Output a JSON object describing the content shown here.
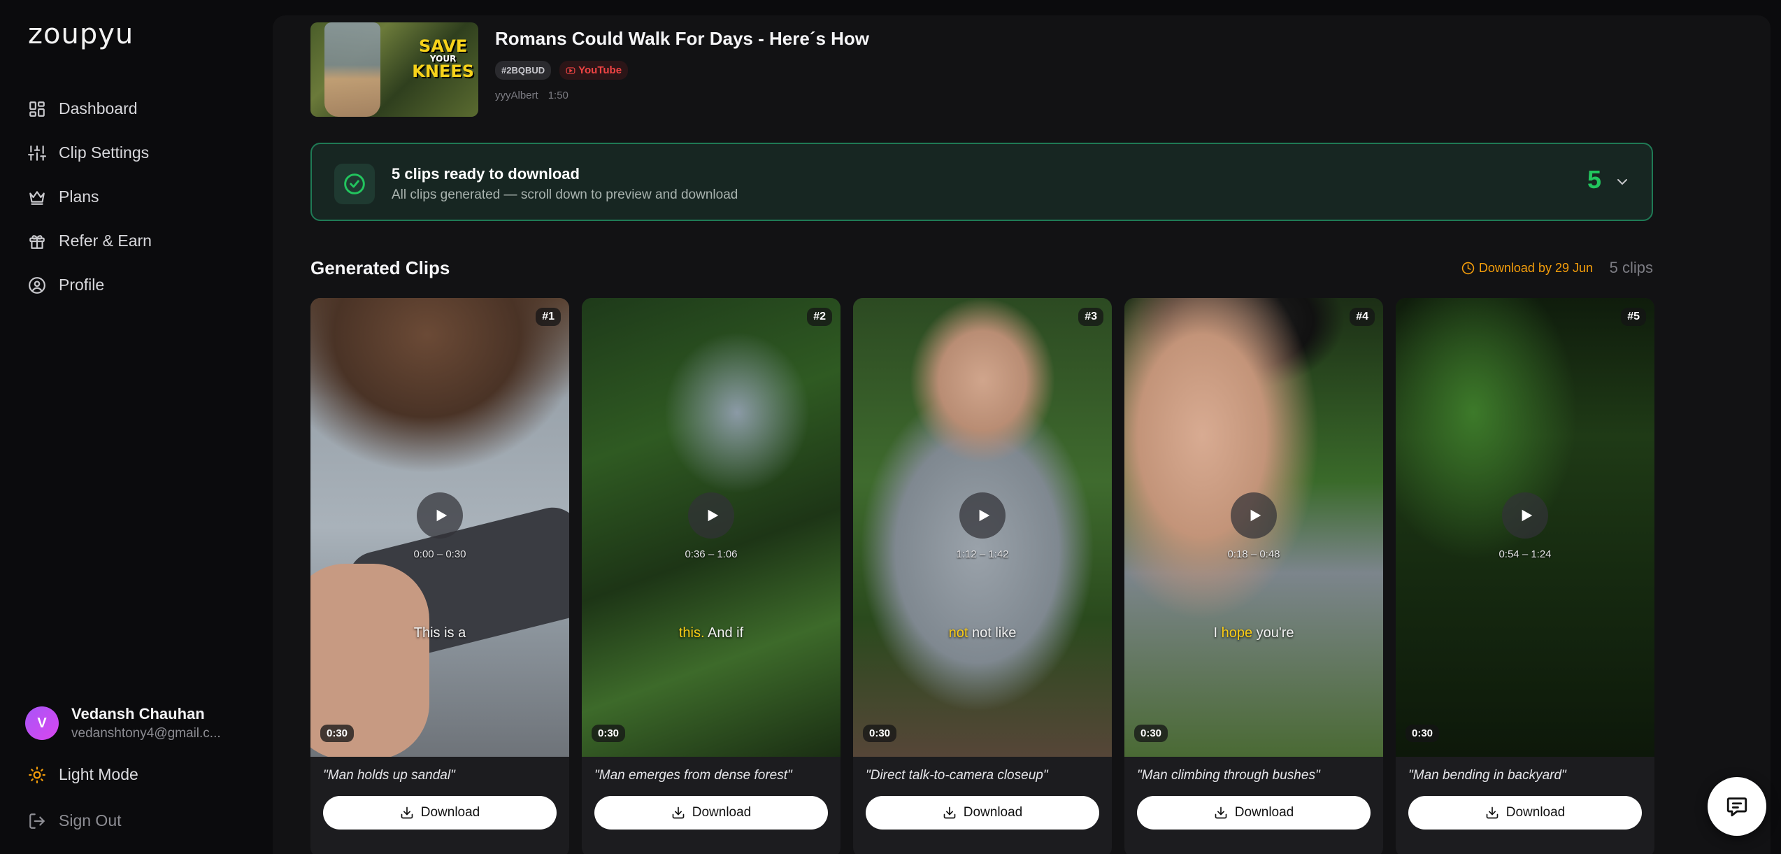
{
  "app": {
    "logo": "zoupyu"
  },
  "sidebar": {
    "items": [
      {
        "label": "Dashboard",
        "icon": "dashboard-icon"
      },
      {
        "label": "Clip Settings",
        "icon": "sliders-icon"
      },
      {
        "label": "Plans",
        "icon": "crown-icon"
      },
      {
        "label": "Refer & Earn",
        "icon": "gift-icon"
      },
      {
        "label": "Profile",
        "icon": "user-circle-icon"
      }
    ],
    "user": {
      "initial": "V",
      "name": "Vedansh Chauhan",
      "email": "vedanshtony4@gmail.c..."
    },
    "light_mode": "Light Mode",
    "sign_out": "Sign Out"
  },
  "video": {
    "title": "Romans Could Walk For Days - Here´s How",
    "id_tag": "#2BQBUD",
    "source": "YouTube",
    "channel": "yyyAlbert",
    "duration": "1:50",
    "thumbnail_text_1": "SAVE",
    "thumbnail_text_2": "YOUR",
    "thumbnail_text_3": "KNEES"
  },
  "ready": {
    "title": "5 clips ready to download",
    "subtitle": "All clips generated — scroll down to preview and download",
    "count": "5"
  },
  "clips_section": {
    "title": "Generated Clips",
    "deadline": "Download by 29 Jun",
    "count_label": "5 clips",
    "download_label": "Download"
  },
  "clips": [
    {
      "num": "#1",
      "range": "0:00 – 0:30",
      "caption_hl": "",
      "caption_rest": "This is a",
      "duration": "0:30",
      "title": "\"Man holds up sandal\""
    },
    {
      "num": "#2",
      "range": "0:36 – 1:06",
      "caption_hl": "this.",
      "caption_rest": " And if",
      "duration": "0:30",
      "title": "\"Man emerges from dense forest\""
    },
    {
      "num": "#3",
      "range": "1:12 – 1:42",
      "caption_hl": "not",
      "caption_rest": " not like",
      "duration": "0:30",
      "title": "\"Direct talk-to-camera closeup\""
    },
    {
      "num": "#4",
      "range": "0:18 – 0:48",
      "caption_pre": "I ",
      "caption_hl": "hope",
      "caption_rest": " you're",
      "duration": "0:30",
      "title": "\"Man climbing through bushes\""
    },
    {
      "num": "#5",
      "range": "0:54 – 1:24",
      "caption_hl": "",
      "caption_rest": "",
      "duration": "0:30",
      "title": "\"Man bending in backyard\""
    }
  ],
  "colors": {
    "accent_green": "#22c55e",
    "deadline_amber": "#f59e0b",
    "caption_highlight": "#facc15",
    "youtube_red": "#ef4444"
  }
}
